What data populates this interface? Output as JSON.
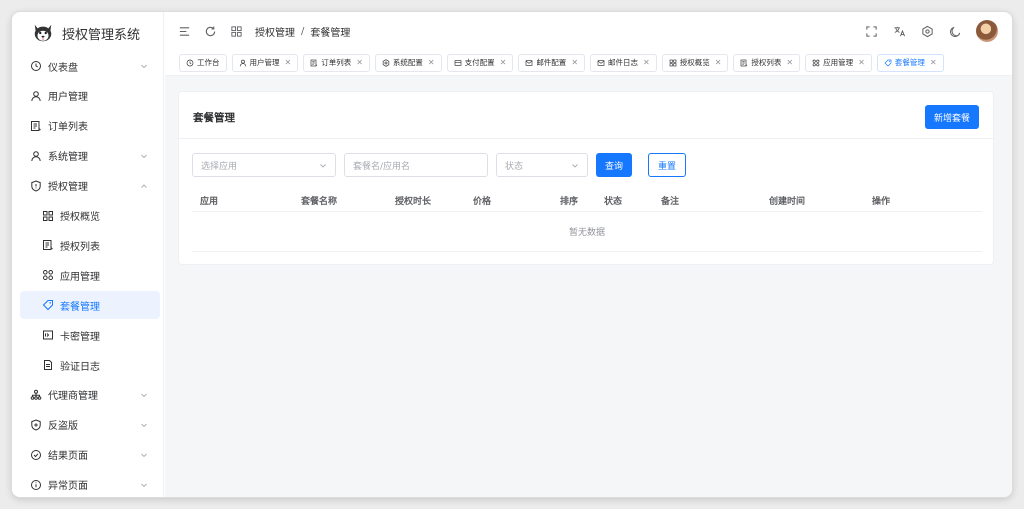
{
  "app": {
    "title": "授权管理系统"
  },
  "sidebar": {
    "items": [
      {
        "label": "仪表盘",
        "icon": "clock-icon",
        "chevron": "down"
      },
      {
        "label": "用户管理",
        "icon": "user-icon"
      },
      {
        "label": "订单列表",
        "icon": "list-icon"
      },
      {
        "label": "系统管理",
        "icon": "user-icon",
        "chevron": "down"
      },
      {
        "label": "授权管理",
        "icon": "shield-icon",
        "chevron": "up"
      },
      {
        "label": "授权概览",
        "icon": "grid-icon",
        "sub": true
      },
      {
        "label": "授权列表",
        "icon": "list-icon",
        "sub": true
      },
      {
        "label": "应用管理",
        "icon": "apps-icon",
        "sub": true
      },
      {
        "label": "套餐管理",
        "icon": "tag-icon",
        "sub": true,
        "active": true
      },
      {
        "label": "卡密管理",
        "icon": "card-icon",
        "sub": true
      },
      {
        "label": "验证日志",
        "icon": "document-icon",
        "sub": true
      },
      {
        "label": "代理商管理",
        "icon": "org-icon",
        "chevron": "down"
      },
      {
        "label": "反盗版",
        "icon": "shield-plus-icon",
        "chevron": "down"
      },
      {
        "label": "结果页面",
        "icon": "check-circle-icon",
        "chevron": "down"
      },
      {
        "label": "异常页面",
        "icon": "info-circle-icon",
        "chevron": "down"
      }
    ]
  },
  "header": {
    "breadcrumb": [
      "授权管理",
      "套餐管理"
    ],
    "separator": "/"
  },
  "tabs": [
    {
      "label": "工作台",
      "icon": "clock-icon",
      "closable": false
    },
    {
      "label": "用户管理",
      "icon": "user-icon",
      "closable": true
    },
    {
      "label": "订单列表",
      "icon": "list-icon",
      "closable": true
    },
    {
      "label": "系统配置",
      "icon": "gear-icon",
      "closable": true
    },
    {
      "label": "支付配置",
      "icon": "payment-icon",
      "closable": true
    },
    {
      "label": "邮件配置",
      "icon": "mail-icon",
      "closable": true
    },
    {
      "label": "邮件日志",
      "icon": "mail-icon",
      "closable": true
    },
    {
      "label": "授权概览",
      "icon": "grid-icon",
      "closable": true
    },
    {
      "label": "授权列表",
      "icon": "list-icon",
      "closable": true
    },
    {
      "label": "应用管理",
      "icon": "apps-icon",
      "closable": true
    },
    {
      "label": "套餐管理",
      "icon": "tag-icon",
      "closable": true,
      "active": true
    }
  ],
  "page": {
    "title": "套餐管理",
    "add_button": "新增套餐"
  },
  "filters": {
    "app_select_placeholder": "选择应用",
    "name_input_placeholder": "套餐名/应用名",
    "status_select_placeholder": "状态",
    "query_button": "查询",
    "reset_button": "重置"
  },
  "table": {
    "columns": [
      "应用",
      "套餐名称",
      "授权时长",
      "价格",
      "排序",
      "状态",
      "备注",
      "创建时间",
      "操作"
    ],
    "empty_text": "暂无数据"
  },
  "colors": {
    "primary": "#1677ff",
    "active_bg": "#ecf3fe"
  }
}
